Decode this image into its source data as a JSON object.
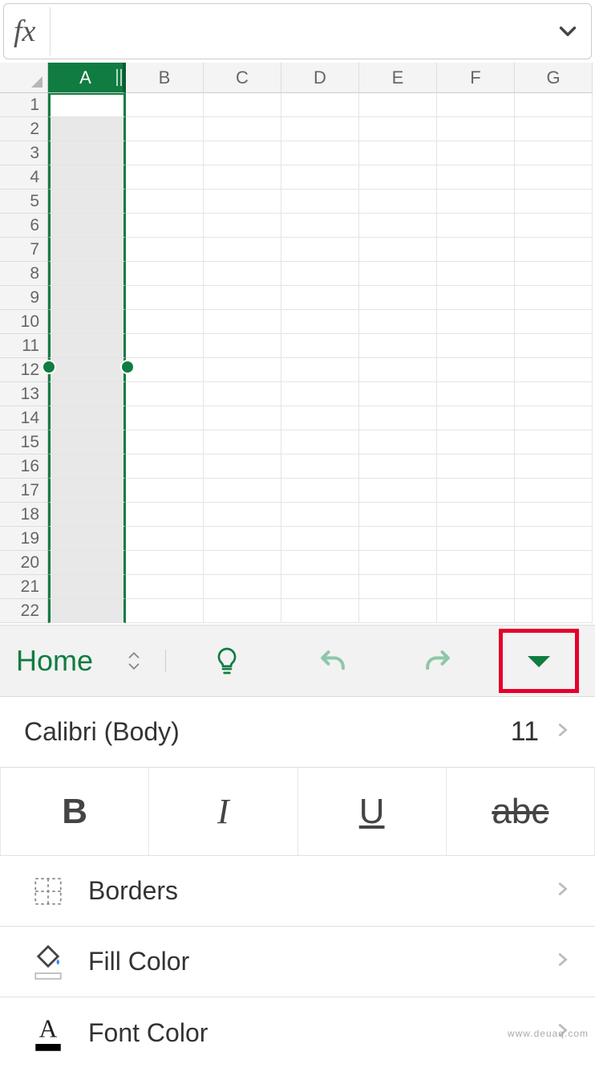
{
  "formula_bar": {
    "fx_label": "fx",
    "value": ""
  },
  "columns": [
    "A",
    "B",
    "C",
    "D",
    "E",
    "F",
    "G"
  ],
  "selected_column_index": 0,
  "rows": [
    1,
    2,
    3,
    4,
    5,
    6,
    7,
    8,
    9,
    10,
    11,
    12,
    13,
    14,
    15,
    16,
    17,
    18,
    19,
    20,
    21,
    22
  ],
  "toolbar": {
    "tab_label": "Home"
  },
  "font_panel": {
    "font_name": "Calibri (Body)",
    "font_size": "11",
    "bold_label": "B",
    "italic_label": "I",
    "underline_label": "U",
    "strike_label": "abc",
    "borders_label": "Borders",
    "fill_label": "Fill Color",
    "fontcolor_label": "Font Color"
  },
  "watermark": "www.deuaq.com"
}
